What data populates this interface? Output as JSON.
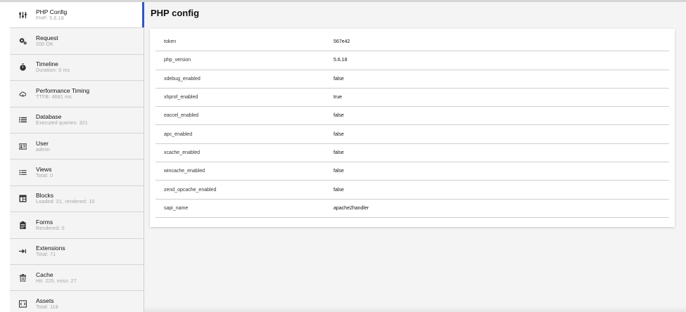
{
  "sidebar": {
    "items": [
      {
        "label": "PHP Config",
        "sub": "PHP: 5.6.18",
        "icon": "sliders-icon"
      },
      {
        "label": "Request",
        "sub": "200 OK",
        "icon": "cogs-icon"
      },
      {
        "label": "Timeline",
        "sub": "Duration: 0 ms",
        "icon": "stopwatch-icon"
      },
      {
        "label": "Performance Timing",
        "sub": "TTFB: 4681 ms",
        "icon": "cloud-icon"
      },
      {
        "label": "Database",
        "sub": "Executed queries: 321",
        "icon": "list-icon"
      },
      {
        "label": "User",
        "sub": "admin",
        "icon": "id-card-icon"
      },
      {
        "label": "Views",
        "sub": "Total: 0",
        "icon": "bullet-list-icon"
      },
      {
        "label": "Blocks",
        "sub": "Loaded: 21, rendered: 10",
        "icon": "layout-icon"
      },
      {
        "label": "Forms",
        "sub": "Rendered: 0",
        "icon": "clipboard-icon"
      },
      {
        "label": "Extensions",
        "sub": "Total: 71",
        "icon": "plug-icon"
      },
      {
        "label": "Cache",
        "sub": "Hit: 225, miss: 27",
        "icon": "trash-icon"
      },
      {
        "label": "Assets",
        "sub": "Total: 118",
        "icon": "code-file-icon"
      }
    ]
  },
  "main": {
    "title": "PHP config",
    "rows": [
      {
        "key": "token",
        "value": "567e42"
      },
      {
        "key": "php_version",
        "value": "5.6.18"
      },
      {
        "key": "xdebug_enabled",
        "value": "false"
      },
      {
        "key": "xhprof_enabled",
        "value": "true"
      },
      {
        "key": "eaccel_enabled",
        "value": "false"
      },
      {
        "key": "apc_enabled",
        "value": "false"
      },
      {
        "key": "xcache_enabled",
        "value": "false"
      },
      {
        "key": "wincache_enabled",
        "value": "false"
      },
      {
        "key": "zend_opcache_enabled",
        "value": "false"
      },
      {
        "key": "sapi_name",
        "value": "apache2handler"
      }
    ]
  },
  "colors": {
    "accent": "#2f57c7",
    "sidebar_bg": "#f4f4f4",
    "divider": "#d4d4d4"
  }
}
